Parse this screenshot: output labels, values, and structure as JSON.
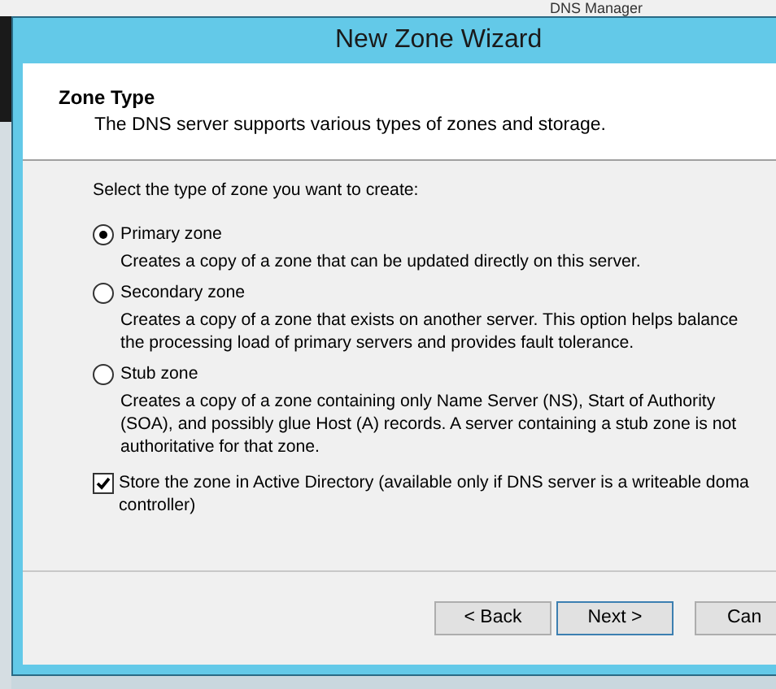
{
  "background_window": {
    "title": "DNS Manager"
  },
  "wizard": {
    "title": "New Zone Wizard"
  },
  "header": {
    "heading": "Zone Type",
    "subtitle": "The DNS server supports various types of zones and storage."
  },
  "prompt": "Select the type of zone you want to create:",
  "options": [
    {
      "label": "Primary zone",
      "selected": true,
      "description": [
        "Creates a copy of a zone that can be updated directly on this server."
      ]
    },
    {
      "label": "Secondary zone",
      "selected": false,
      "description": [
        "Creates a copy of a zone that exists on another server. This option helps balance",
        "the processing load of primary servers and provides fault tolerance."
      ]
    },
    {
      "label": "Stub zone",
      "selected": false,
      "description": [
        "Creates a copy of a zone containing only Name Server (NS), Start of Authority",
        "(SOA), and possibly glue Host (A) records. A server containing a stub zone is not",
        "authoritative for that zone."
      ]
    }
  ],
  "store_in_ad": {
    "checked": true,
    "label": [
      "Store the zone in Active Directory (available only if DNS server is a writeable doma",
      "controller)"
    ]
  },
  "buttons": [
    {
      "label": "< Back",
      "default": false
    },
    {
      "label": "Next >",
      "default": true
    },
    {
      "label": "Can",
      "default": false
    }
  ]
}
